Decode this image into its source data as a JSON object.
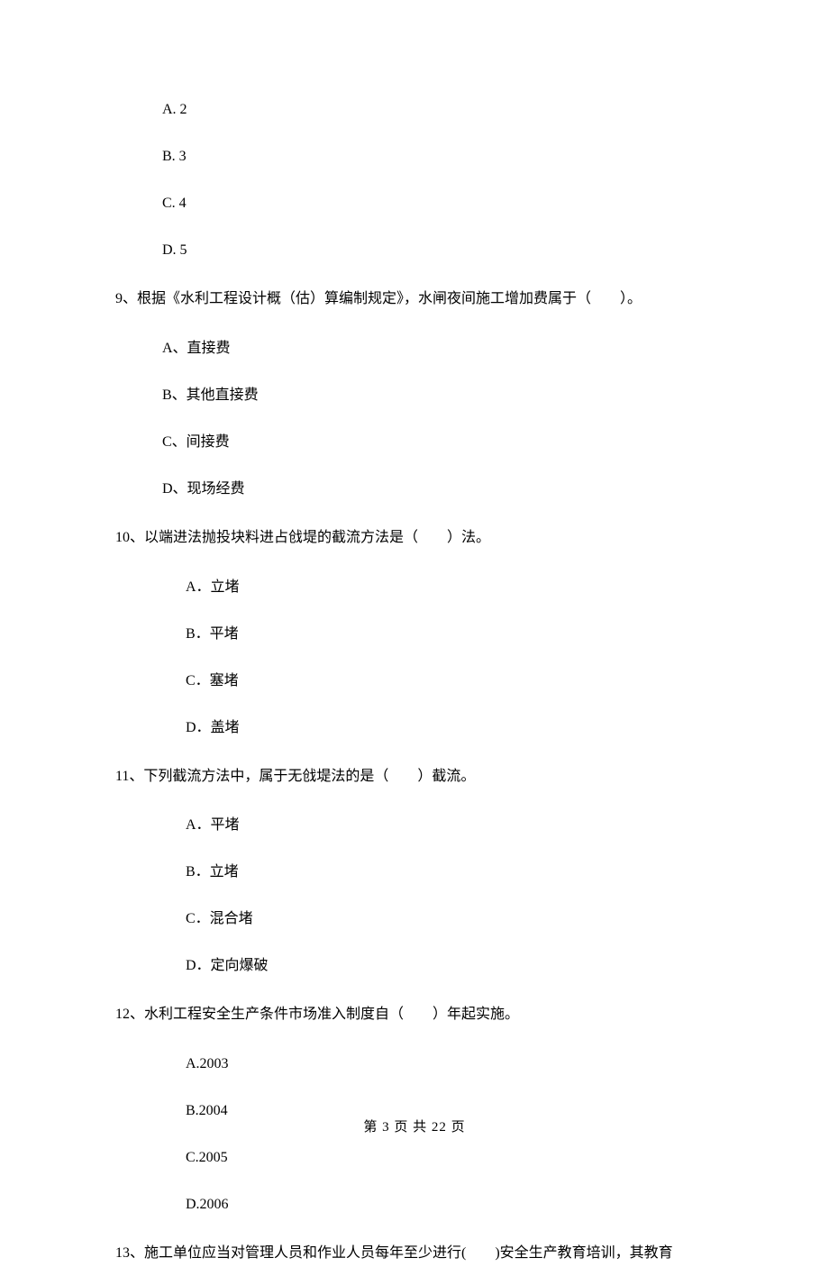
{
  "topOptions": {
    "a": "A. 2",
    "b": "B. 3",
    "c": "C. 4",
    "d": "D. 5"
  },
  "q9": {
    "text": "9、根据《水利工程设计概（估）算编制规定》，水闸夜间施工增加费属于（　　）。",
    "a": "A、直接费",
    "b": "B、其他直接费",
    "c": "C、间接费",
    "d": "D、现场经费"
  },
  "q10": {
    "text": "10、以端进法抛投块料进占戗堤的截流方法是（　　）法。",
    "a": "A．立堵",
    "b": "B．平堵",
    "c": "C．塞堵",
    "d": "D．盖堵"
  },
  "q11": {
    "text": "11、下列截流方法中，属于无戗堤法的是（　　）截流。",
    "a": "A．平堵",
    "b": "B．立堵",
    "c": "C．混合堵",
    "d": "D．定向爆破"
  },
  "q12": {
    "text": "12、水利工程安全生产条件市场准入制度自（　　）年起实施。",
    "a": "A.2003",
    "b": "B.2004",
    "c": "C.2005",
    "d": "D.2006"
  },
  "q13": {
    "text": "13、施工单位应当对管理人员和作业人员每年至少进行(　　)安全生产教育培训，其教育"
  },
  "footer": "第 3 页 共 22 页"
}
